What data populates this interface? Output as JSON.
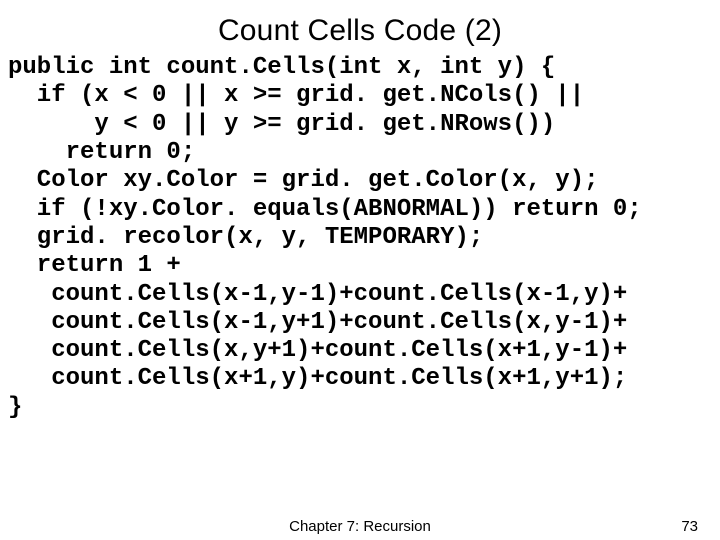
{
  "title": "Count Cells Code (2)",
  "code_lines": [
    "public int count.Cells(int x, int y) {",
    "  if (x < 0 || x >= grid. get.NCols() ||",
    "      y < 0 || y >= grid. get.NRows())",
    "    return 0;",
    "  Color xy.Color = grid. get.Color(x, y);",
    "  if (!xy.Color. equals(ABNORMAL)) return 0;",
    "  grid. recolor(x, y, TEMPORARY);",
    "  return 1 +",
    "   count.Cells(x-1,y-1)+count.Cells(x-1,y)+",
    "   count.Cells(x-1,y+1)+count.Cells(x,y-1)+",
    "   count.Cells(x,y+1)+count.Cells(x+1,y-1)+",
    "   count.Cells(x+1,y)+count.Cells(x+1,y+1);",
    "}"
  ],
  "footer": {
    "chapter": "Chapter 7: Recursion",
    "page": "73"
  }
}
